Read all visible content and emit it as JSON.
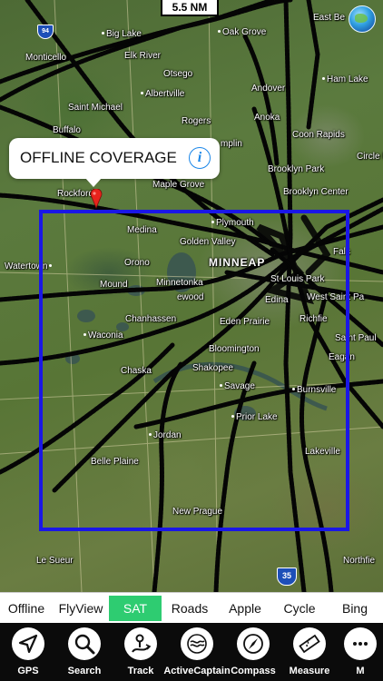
{
  "map": {
    "scale_label": "5.5 NM",
    "coverage_callout": {
      "title": "OFFLINE COVERAGE",
      "info_glyph": "i"
    },
    "highway_shields": [
      "35",
      "94"
    ],
    "places": [
      "East Be",
      "Big Lake",
      "Oak Grove",
      "Monticello",
      "Elk River",
      "Otsego",
      "Ham Lake",
      "Andover",
      "Albertville",
      "Saint Michael",
      "Rogers",
      "Anoka",
      "Buffalo",
      "Coon Rapids",
      "Circle P",
      "mplin",
      "Brooklyn Park",
      "Rockford",
      "Maple Grove",
      "Brooklyn Center",
      "Medina",
      "Plymouth",
      "Golden Valley",
      "Watertown",
      "Orono",
      "MINNEAP",
      "St Louis Park",
      "Falc",
      "Mound",
      "Minnetonka",
      "Edina",
      "West Saint Pa",
      "Waconia",
      "Chanhassen",
      "Eden Prairie",
      "Richfie",
      "Bloomington",
      "Saint Paul",
      "Eagan",
      "Chaska",
      "Shakopee",
      "Savage",
      "Burnsville",
      "Prior Lake",
      "Jordan",
      "Lakeville",
      "Belle Plaine",
      "New Prague",
      "Le Sueur",
      "Northfie",
      "ewood"
    ]
  },
  "map_types": {
    "items": [
      "Offline",
      "FlyView",
      "SAT",
      "Roads",
      "Apple",
      "Cycle",
      "Bing"
    ],
    "active": "SAT"
  },
  "toolbar": {
    "items": [
      {
        "label": "GPS",
        "icon": "gps-arrow-icon"
      },
      {
        "label": "Search",
        "icon": "search-icon"
      },
      {
        "label": "Track",
        "icon": "track-icon"
      },
      {
        "label": "ActiveCaptain",
        "icon": "activecaptain-icon"
      },
      {
        "label": "Compass",
        "icon": "compass-icon"
      },
      {
        "label": "Measure",
        "icon": "ruler-icon"
      },
      {
        "label": "M",
        "icon": "more-icon"
      }
    ]
  },
  "colors": {
    "coverage_border": "#1a17e6",
    "active_map_type": "#2ecc71",
    "toolbar_background": "#0b0b0b",
    "info_icon": "#1a86e8",
    "pin": "#e8231c"
  }
}
